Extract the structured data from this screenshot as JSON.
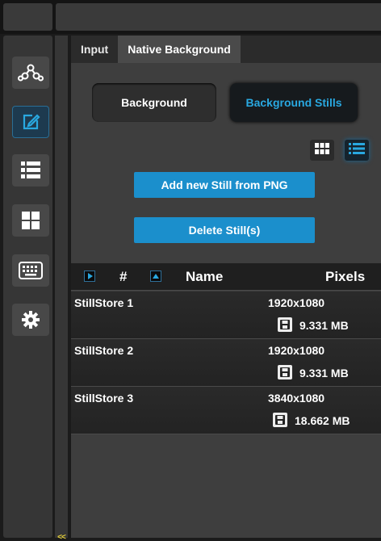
{
  "tabs": [
    {
      "label": "Input"
    },
    {
      "label": "Native Background"
    }
  ],
  "mode_buttons": {
    "background": "Background",
    "background_stills": "Background Stills"
  },
  "actions": {
    "add": "Add new Still from PNG",
    "delete": "Delete Still(s)"
  },
  "table": {
    "headers": {
      "number": "#",
      "name": "Name",
      "pixels": "Pixels"
    },
    "rows": [
      {
        "name": "StillStore 1",
        "pixels": "1920x1080",
        "size": "9.331 MB"
      },
      {
        "name": "StillStore 2",
        "pixels": "1920x1080",
        "size": "9.331 MB"
      },
      {
        "name": "StillStore 3",
        "pixels": "3840x1080",
        "size": "18.662 MB"
      }
    ]
  },
  "collapse_label": "<<",
  "sidebar_icons": [
    "network-icon",
    "edit-icon",
    "list-icon",
    "grid-icon",
    "keyboard-icon",
    "gear-icon"
  ],
  "colors": {
    "accent": "#1b8fcc",
    "active_text": "#29a8e0",
    "collapse": "#e8d23a"
  }
}
